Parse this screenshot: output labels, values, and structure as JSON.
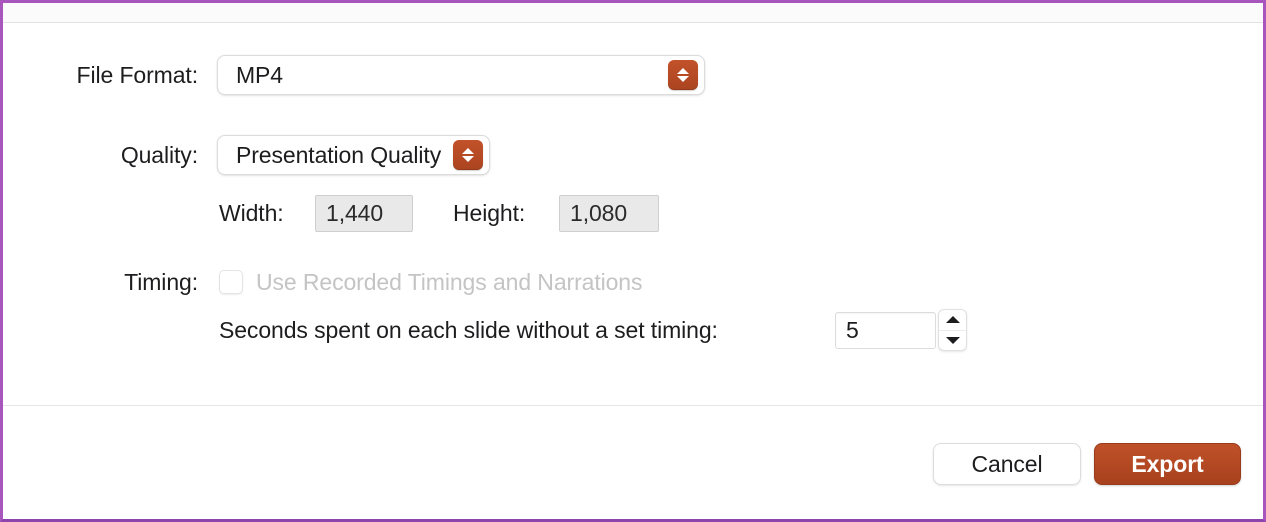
{
  "dialog": {
    "accent_color": "#b34a22",
    "frame_color": "#a855bd"
  },
  "form": {
    "file_format": {
      "label": "File Format:",
      "value": "MP4"
    },
    "quality": {
      "label": "Quality:",
      "value": "Presentation Quality"
    },
    "dimensions": {
      "width_label": "Width:",
      "width_value": "1,440",
      "height_label": "Height:",
      "height_value": "1,080"
    },
    "timing": {
      "label": "Timing:",
      "checkbox_label": "Use Recorded Timings and Narrations",
      "checkbox_checked": false,
      "seconds_label": "Seconds spent on each slide without a set timing:",
      "seconds_value": "5"
    }
  },
  "footer": {
    "cancel_label": "Cancel",
    "export_label": "Export"
  }
}
